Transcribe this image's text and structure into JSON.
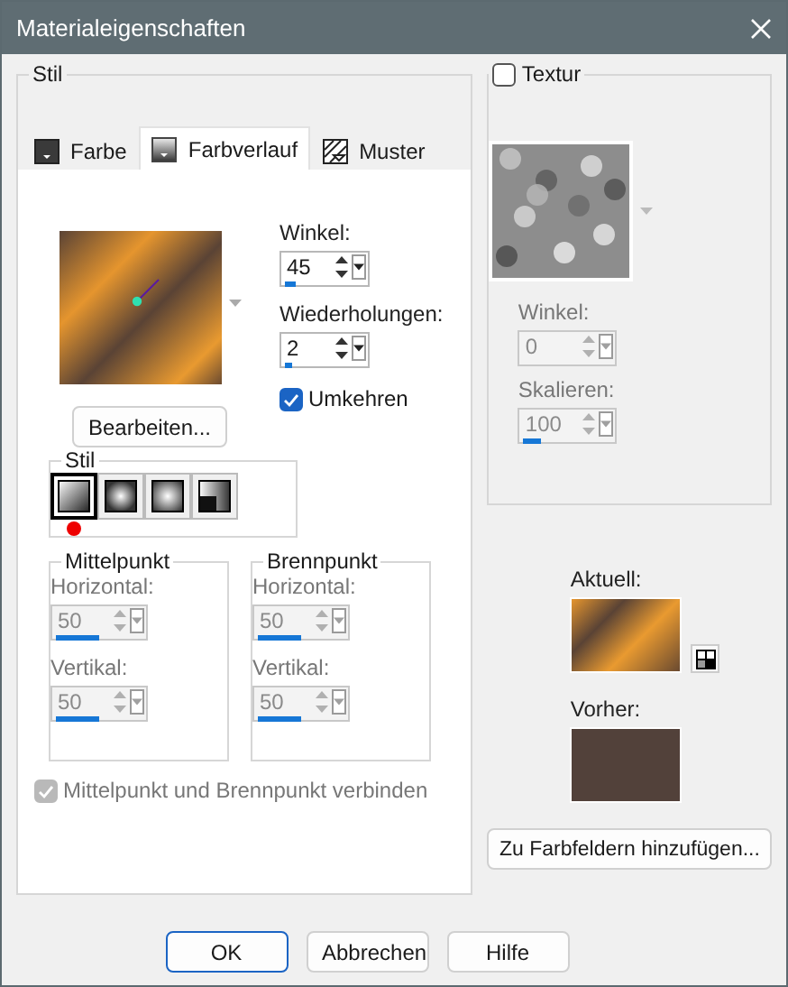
{
  "window": {
    "title": "Materialeigenschaften"
  },
  "style_group": {
    "title": "Stil",
    "tabs": [
      {
        "label": "Farbe",
        "kind": "color",
        "selected": false
      },
      {
        "label": "Farbverlauf",
        "kind": "gradient",
        "selected": true
      },
      {
        "label": "Muster",
        "kind": "pattern",
        "selected": false
      }
    ],
    "gradient": {
      "angle": {
        "label": "Winkel:",
        "value": "45",
        "level": 0.125,
        "disabled": false
      },
      "repeats": {
        "label": "Wiederholungen:",
        "value": "2",
        "level": 0.1,
        "disabled": false
      },
      "invert": {
        "label": "Umkehren",
        "checked": true,
        "disabled": false
      },
      "edit_button": "Bearbeiten...",
      "style": {
        "title": "Stil",
        "options": [
          {
            "kind": "linear",
            "selected": true
          },
          {
            "kind": "rectangular",
            "selected": false
          },
          {
            "kind": "radial",
            "selected": false
          },
          {
            "kind": "corner",
            "selected": false
          }
        ]
      },
      "center": {
        "title": "Mittelpunkt",
        "fields": [
          {
            "label": "Horizontal:",
            "value": "50",
            "level": 0.5,
            "disabled": true
          },
          {
            "label": "Vertikal:",
            "value": "50",
            "level": 0.5,
            "disabled": true
          }
        ]
      },
      "focus": {
        "title": "Brennpunkt",
        "fields": [
          {
            "label": "Horizontal:",
            "value": "50",
            "level": 0.5,
            "disabled": true
          },
          {
            "label": "Vertikal:",
            "value": "50",
            "level": 0.5,
            "disabled": true
          }
        ]
      },
      "link": {
        "label": "Mittelpunkt und Brennpunkt verbinden",
        "checked": true,
        "disabled": true
      }
    }
  },
  "texture": {
    "label": "Textur",
    "checked": false,
    "fields": [
      {
        "label": "Winkel:",
        "value": "0",
        "disabled": true
      },
      {
        "label": "Skalieren:",
        "value": "100",
        "level": 0.2,
        "disabled": true
      }
    ]
  },
  "current": {
    "label": "Aktuell:"
  },
  "previous": {
    "label": "Vorher:"
  },
  "add_button": "Zu Farbfeldern hinzufügen...",
  "buttons": [
    {
      "label": "OK",
      "default": true
    },
    {
      "label": "Abbrechen",
      "default": false
    },
    {
      "label": "Hilfe",
      "default": false
    }
  ]
}
